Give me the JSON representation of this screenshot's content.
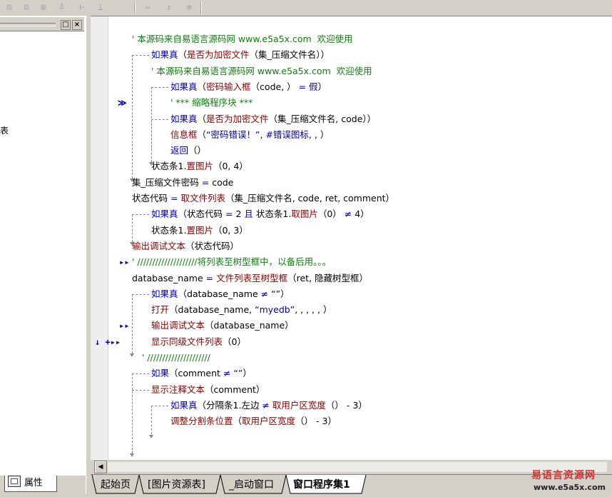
{
  "toolbar": {
    "buttons": [
      "align-left-icon",
      "align-center-icon",
      "align-right-icon",
      "align-top-icon",
      "align-middle-icon",
      "align-bottom-icon",
      "same-width-icon",
      "same-height-icon",
      "same-size-icon"
    ]
  },
  "left_panel": {
    "side_text": "表",
    "tab_label": "属性",
    "buttons": [
      "□",
      "×"
    ]
  },
  "editor": {
    "lines": [
      [
        {
          "c": "cm",
          "t": "' 本源码来自易语言源码网 www.e5a5x.com  欢迎使用"
        }
      ],
      [
        {
          "c": "kw",
          "t": "如果真"
        },
        {
          "c": "txt",
          "t": "（"
        },
        {
          "c": "fn",
          "t": "是否为加密文件"
        },
        {
          "c": "txt",
          "t": "（集_压缩文件名））"
        }
      ],
      [
        {
          "c": "cm",
          "t": "' 本源码来自易语言源码网 www.e5a5x.com  欢迎使用"
        }
      ],
      [
        {
          "c": "kw",
          "t": "如果真"
        },
        {
          "c": "txt",
          "t": "（"
        },
        {
          "c": "fn",
          "t": "密码输入框"
        },
        {
          "c": "txt",
          "t": "（code, ）"
        },
        {
          "c": "kw",
          "t": " = 假"
        },
        {
          "c": "txt",
          "t": "）"
        }
      ],
      [
        {
          "c": "cm",
          "t": "' *** 缩略程序块 ***"
        }
      ],
      [
        {
          "c": "kw",
          "t": "如果真"
        },
        {
          "c": "txt",
          "t": "（"
        },
        {
          "c": "fn",
          "t": "是否为加密文件"
        },
        {
          "c": "txt",
          "t": "（集_压缩文件名, code））"
        }
      ],
      [
        {
          "c": "fn",
          "t": "信息框"
        },
        {
          "c": "txt",
          "t": "（"
        },
        {
          "c": "st",
          "t": "“密码错误！”"
        },
        {
          "c": "txt",
          "t": ", "
        },
        {
          "c": "st",
          "t": "#错误图标"
        },
        {
          "c": "txt",
          "t": ", , ）"
        }
      ],
      [
        {
          "c": "kw",
          "t": "返回"
        },
        {
          "c": "txt",
          "t": "（）"
        }
      ],
      [
        {
          "c": "txt",
          "t": "状态条1."
        },
        {
          "c": "fn",
          "t": "置图片"
        },
        {
          "c": "txt",
          "t": "（0, 4）"
        }
      ],
      [
        {
          "c": "txt",
          "t": "集_压缩文件密码 "
        },
        {
          "c": "kw",
          "t": "="
        },
        {
          "c": "txt",
          "t": " code"
        }
      ],
      [
        {
          "c": "txt",
          "t": "状态代码 "
        },
        {
          "c": "kw",
          "t": "="
        },
        {
          "c": "txt",
          "t": " "
        },
        {
          "c": "fn",
          "t": "取文件列表"
        },
        {
          "c": "txt",
          "t": "（集_压缩文件名, code, ret, comment）"
        }
      ],
      [
        {
          "c": "kw",
          "t": "如果真"
        },
        {
          "c": "txt",
          "t": "（状态代码 "
        },
        {
          "c": "kw",
          "t": "="
        },
        {
          "c": "txt",
          "t": " 2 "
        },
        {
          "c": "kw",
          "t": "且"
        },
        {
          "c": "txt",
          "t": " 状态条1."
        },
        {
          "c": "fn",
          "t": "取图片"
        },
        {
          "c": "txt",
          "t": "（0）"
        },
        {
          "c": "kw",
          "t": " ≠ "
        },
        {
          "c": "txt",
          "t": "4）"
        }
      ],
      [
        {
          "c": "txt",
          "t": "状态条1."
        },
        {
          "c": "fn",
          "t": "置图片"
        },
        {
          "c": "txt",
          "t": "（0, 3）"
        }
      ],
      [
        {
          "c": "fn",
          "t": "输出调试文本"
        },
        {
          "c": "txt",
          "t": "（状态代码）"
        }
      ],
      [
        {
          "c": "cm",
          "t": "' ////////////////////将列表至树型框中，以备后用。。。"
        }
      ],
      [
        {
          "c": "txt",
          "t": "database_name "
        },
        {
          "c": "kw",
          "t": "="
        },
        {
          "c": "txt",
          "t": " "
        },
        {
          "c": "fn",
          "t": "文件列表至树型框"
        },
        {
          "c": "txt",
          "t": "（ret, 隐藏树型框）"
        }
      ],
      [
        {
          "c": "kw",
          "t": "如果真"
        },
        {
          "c": "txt",
          "t": "（database_name "
        },
        {
          "c": "kw",
          "t": "≠"
        },
        {
          "c": "txt",
          "t": " "
        },
        {
          "c": "st",
          "t": "“”"
        },
        {
          "c": "txt",
          "t": "）"
        }
      ],
      [
        {
          "c": "fn",
          "t": "打开"
        },
        {
          "c": "txt",
          "t": "（database_name, "
        },
        {
          "c": "st",
          "t": "“myedb”"
        },
        {
          "c": "txt",
          "t": ", , , , , ）"
        }
      ],
      [
        {
          "c": "fn",
          "t": "输出调试文本"
        },
        {
          "c": "txt",
          "t": "（database_name）"
        }
      ],
      [
        {
          "c": "fn",
          "t": "显示同级文件列表"
        },
        {
          "c": "txt",
          "t": "（0）"
        }
      ],
      [
        {
          "c": "cm",
          "t": "' /////////////////////"
        }
      ],
      [
        {
          "c": "kw",
          "t": "如果"
        },
        {
          "c": "txt",
          "t": "（comment "
        },
        {
          "c": "kw",
          "t": "≠"
        },
        {
          "c": "txt",
          "t": " "
        },
        {
          "c": "st",
          "t": "“”"
        },
        {
          "c": "txt",
          "t": "）"
        }
      ],
      [
        {
          "c": "fn",
          "t": "显示注释文本"
        },
        {
          "c": "txt",
          "t": "（comment）"
        }
      ],
      [
        {
          "c": "kw",
          "t": "如果真"
        },
        {
          "c": "txt",
          "t": "（分隔条1.左边 "
        },
        {
          "c": "kw",
          "t": "≠"
        },
        {
          "c": "txt",
          "t": " "
        },
        {
          "c": "fn",
          "t": "取用户区宽度"
        },
        {
          "c": "txt",
          "t": "（）"
        },
        {
          "c": "kw",
          "t": " - "
        },
        {
          "c": "txt",
          "t": "3）"
        }
      ],
      [
        {
          "c": "fn",
          "t": "调整分割条位置"
        },
        {
          "c": "txt",
          "t": "（"
        },
        {
          "c": "fn",
          "t": "取用户区宽度"
        },
        {
          "c": "txt",
          "t": "（）"
        },
        {
          "c": "kw",
          "t": " - "
        },
        {
          "c": "txt",
          "t": "3）"
        }
      ]
    ],
    "markers": [
      {
        "line": 4,
        "text": "≫"
      },
      {
        "line": 14,
        "text": "▸▸"
      },
      {
        "line": 18,
        "text": "▸▸"
      },
      {
        "line": 19,
        "text": "↓ +▸▸"
      }
    ]
  },
  "tabs": [
    {
      "label": "起始页",
      "active": false,
      "color": "#0000aa"
    },
    {
      "label": "[图片资源表]",
      "active": false,
      "color": "#808000"
    },
    {
      "label": "_启动窗口",
      "active": false,
      "color": "#000000"
    },
    {
      "label": "窗口程序集1",
      "active": true,
      "color": "#000000"
    }
  ],
  "scrollbar": {
    "left_arrow": "◀"
  },
  "watermark": {
    "title": "易语言资源网",
    "url": "www.e5a5x.com"
  }
}
